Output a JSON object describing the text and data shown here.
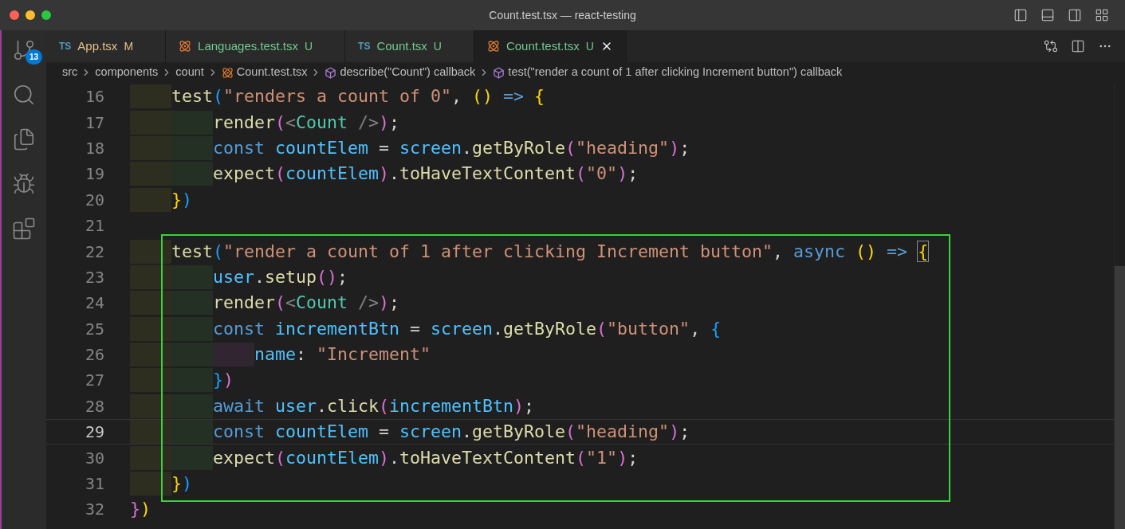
{
  "window": {
    "title": "Count.test.tsx — react-testing"
  },
  "activity_bar": [
    {
      "kind": "source-control",
      "badge": "13"
    },
    {
      "kind": "search"
    },
    {
      "kind": "explorer"
    },
    {
      "kind": "run-debug"
    },
    {
      "kind": "extensions"
    }
  ],
  "tabs": [
    {
      "kind": "ts",
      "icon_text": "TS",
      "label": "App.tsx",
      "status": "M",
      "color": "#e2c08d",
      "selected": false
    },
    {
      "kind": "react",
      "label": "Languages.test.tsx",
      "status": "U",
      "color": "#73c991",
      "selected": false
    },
    {
      "kind": "ts",
      "icon_text": "TS",
      "label": "Count.tsx",
      "status": "U",
      "color": "#73c991",
      "selected": false
    },
    {
      "kind": "react",
      "label": "Count.test.tsx",
      "status": "U",
      "color": "#73c991",
      "selected": true
    }
  ],
  "breadcrumbs": [
    {
      "kind": "folder",
      "label": "src"
    },
    {
      "kind": "folder",
      "label": "components"
    },
    {
      "kind": "folder",
      "label": "count"
    },
    {
      "kind": "react",
      "label": "Count.test.tsx"
    },
    {
      "kind": "symbol",
      "label": "describe(\"Count\") callback"
    },
    {
      "kind": "symbol",
      "label": "test(\"render a count of 1 after clicking Increment button\") callback"
    }
  ],
  "lines": [
    {
      "number": "16",
      "current": false,
      "boxed": false,
      "tokens": [
        {
          "kind": "fn",
          "text": "test"
        },
        {
          "kind": "blue",
          "text": "("
        },
        {
          "kind": "string",
          "text": "\"renders a count of 0\""
        },
        {
          "kind": "plain",
          "text": ", "
        },
        {
          "kind": "yellow",
          "text": "()"
        },
        {
          "kind": "keyword",
          "text": " =>"
        },
        {
          "kind": "yellow",
          "text": " {"
        }
      ],
      "children": [
        {
          "number": "17",
          "current": false,
          "boxed": false,
          "tokens": [
            {
              "kind": "fn",
              "text": "render"
            },
            {
              "kind": "pink",
              "text": "("
            },
            {
              "kind": "punct",
              "text": "<"
            },
            {
              "kind": "component",
              "text": "Count"
            },
            {
              "kind": "punct",
              "text": " />"
            },
            {
              "kind": "pink",
              "text": ")"
            },
            {
              "kind": "plain",
              "text": ";"
            }
          ]
        },
        {
          "number": "18",
          "current": false,
          "boxed": false,
          "tokens": [
            {
              "kind": "keyword",
              "text": "const "
            },
            {
              "kind": "var",
              "text": "countElem"
            },
            {
              "kind": "plain",
              "text": " = "
            },
            {
              "kind": "var",
              "text": "screen"
            },
            {
              "kind": "plain",
              "text": "."
            },
            {
              "kind": "fn",
              "text": "getByRole"
            },
            {
              "kind": "pink",
              "text": "("
            },
            {
              "kind": "string",
              "text": "\"heading\""
            },
            {
              "kind": "pink",
              "text": ")"
            },
            {
              "kind": "plain",
              "text": ";"
            }
          ]
        },
        {
          "number": "19",
          "current": false,
          "boxed": false,
          "tokens": [
            {
              "kind": "fn",
              "text": "expect"
            },
            {
              "kind": "pink",
              "text": "("
            },
            {
              "kind": "var",
              "text": "countElem"
            },
            {
              "kind": "pink",
              "text": ")"
            },
            {
              "kind": "plain",
              "text": "."
            },
            {
              "kind": "fn",
              "text": "toHaveTextContent"
            },
            {
              "kind": "pink",
              "text": "("
            },
            {
              "kind": "string",
              "text": "\"0\""
            },
            {
              "kind": "pink",
              "text": ")"
            },
            {
              "kind": "plain",
              "text": ";"
            }
          ]
        }
      ]
    },
    {
      "number": "20",
      "current": false,
      "boxed": false,
      "tokens": [
        {
          "kind": "yellow",
          "text": "}"
        },
        {
          "kind": "blue",
          "text": ")"
        }
      ]
    },
    {
      "number": "21",
      "current": false
    },
    {
      "number": "22",
      "current": false,
      "boxed": true,
      "tokens": [
        {
          "kind": "fn",
          "text": "test"
        },
        {
          "kind": "blue",
          "text": "("
        },
        {
          "kind": "string",
          "text": "\"render a count of 1 after clicking Increment button\""
        },
        {
          "kind": "plain",
          "text": ", "
        },
        {
          "kind": "keyword",
          "text": "async "
        },
        {
          "kind": "yellow",
          "text": "()"
        },
        {
          "kind": "keyword",
          "text": " => "
        },
        {
          "kind": "match",
          "text": "{"
        }
      ],
      "children": [
        {
          "number": "23",
          "current": false,
          "boxed": true,
          "tokens": [
            {
              "kind": "var",
              "text": "user"
            },
            {
              "kind": "plain",
              "text": "."
            },
            {
              "kind": "fn",
              "text": "setup"
            },
            {
              "kind": "pink",
              "text": "()"
            },
            {
              "kind": "plain",
              "text": ";"
            }
          ]
        },
        {
          "number": "24",
          "current": false,
          "boxed": true,
          "tokens": [
            {
              "kind": "fn",
              "text": "render"
            },
            {
              "kind": "pink",
              "text": "("
            },
            {
              "kind": "punct",
              "text": "<"
            },
            {
              "kind": "component",
              "text": "Count"
            },
            {
              "kind": "punct",
              "text": " />"
            },
            {
              "kind": "pink",
              "text": ")"
            },
            {
              "kind": "plain",
              "text": ";"
            }
          ]
        },
        {
          "number": "25",
          "current": false,
          "boxed": true,
          "tokens": [
            {
              "kind": "keyword",
              "text": "const "
            },
            {
              "kind": "var",
              "text": "incrementBtn"
            },
            {
              "kind": "plain",
              "text": " = "
            },
            {
              "kind": "var",
              "text": "screen"
            },
            {
              "kind": "plain",
              "text": "."
            },
            {
              "kind": "fn",
              "text": "getByRole"
            },
            {
              "kind": "pink",
              "text": "("
            },
            {
              "kind": "string",
              "text": "\"button\""
            },
            {
              "kind": "plain",
              "text": ", "
            },
            {
              "kind": "blue",
              "text": "{"
            }
          ],
          "children": [
            {
              "number": "26",
              "current": false,
              "boxed": true,
              "tokens": [
                {
                  "kind": "var",
                  "text": "name"
                },
                {
                  "kind": "plain",
                  "text": ": "
                },
                {
                  "kind": "string",
                  "text": "\"Increment\""
                }
              ]
            }
          ]
        },
        {
          "number": "27",
          "current": false,
          "boxed": true,
          "tokens": [
            {
              "kind": "blue",
              "text": "}"
            },
            {
              "kind": "pink",
              "text": ")"
            }
          ]
        },
        {
          "number": "28",
          "current": false,
          "boxed": true,
          "tokens": [
            {
              "kind": "keyword",
              "text": "await "
            },
            {
              "kind": "var",
              "text": "user"
            },
            {
              "kind": "plain",
              "text": "."
            },
            {
              "kind": "fn",
              "text": "click"
            },
            {
              "kind": "pink",
              "text": "("
            },
            {
              "kind": "var",
              "text": "incrementBtn"
            },
            {
              "kind": "pink",
              "text": ")"
            },
            {
              "kind": "plain",
              "text": ";"
            }
          ]
        },
        {
          "number": "29",
          "current": true,
          "boxed": true,
          "tokens": [
            {
              "kind": "keyword",
              "text": "const "
            },
            {
              "kind": "var",
              "text": "countElem"
            },
            {
              "kind": "plain",
              "text": " = "
            },
            {
              "kind": "var",
              "text": "screen"
            },
            {
              "kind": "plain",
              "text": "."
            },
            {
              "kind": "fn",
              "text": "getByRole"
            },
            {
              "kind": "pink",
              "text": "("
            },
            {
              "kind": "string",
              "text": "\"heading\""
            },
            {
              "kind": "pink",
              "text": ")"
            },
            {
              "kind": "plain",
              "text": ";"
            }
          ]
        },
        {
          "number": "30",
          "current": false,
          "boxed": true,
          "tokens": [
            {
              "kind": "fn",
              "text": "expect"
            },
            {
              "kind": "pink",
              "text": "("
            },
            {
              "kind": "var",
              "text": "countElem"
            },
            {
              "kind": "pink",
              "text": ")"
            },
            {
              "kind": "plain",
              "text": "."
            },
            {
              "kind": "fn",
              "text": "toHaveTextContent"
            },
            {
              "kind": "pink",
              "text": "("
            },
            {
              "kind": "string",
              "text": "\"1\""
            },
            {
              "kind": "pink",
              "text": ")"
            },
            {
              "kind": "plain",
              "text": ";"
            }
          ]
        }
      ]
    },
    {
      "number": "31",
      "current": false,
      "boxed": true,
      "tokens": [
        {
          "kind": "yellow",
          "text": "}"
        },
        {
          "kind": "blue",
          "text": ")"
        }
      ]
    }
  ],
  "closing_lines": [
    {
      "number": "32",
      "current": false,
      "boxed": false,
      "tokens": [
        {
          "kind": "pink",
          "text": "}"
        },
        {
          "kind": "yellow",
          "text": ")"
        }
      ]
    }
  ]
}
